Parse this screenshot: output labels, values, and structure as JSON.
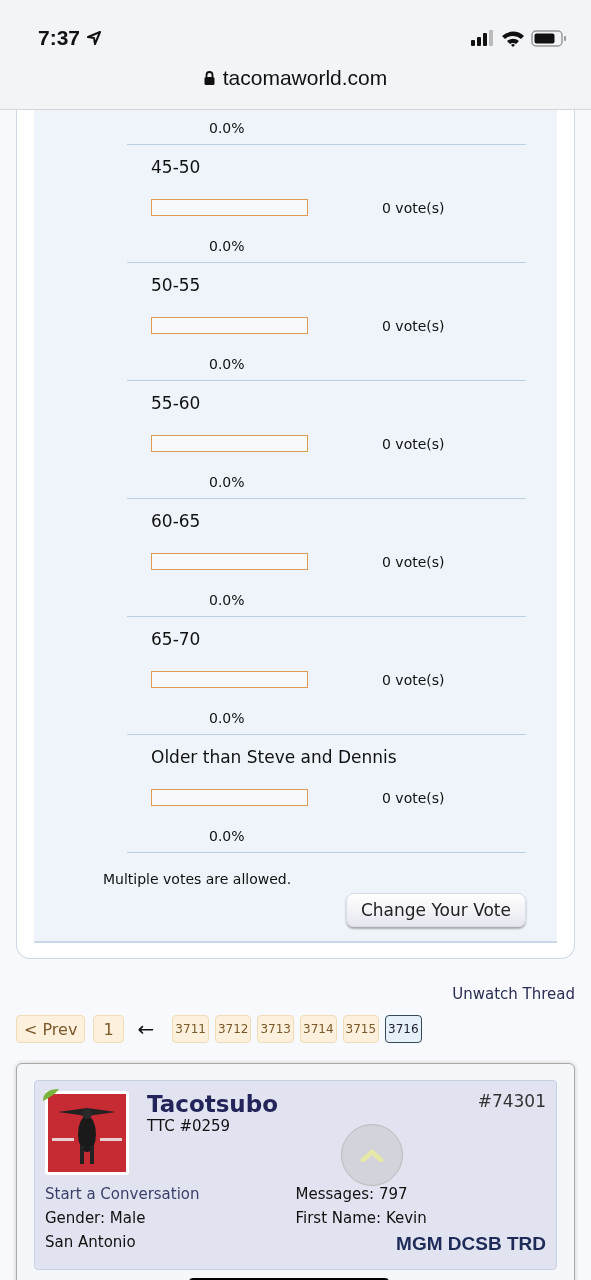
{
  "status_bar": {
    "time": "7:37"
  },
  "browser": {
    "url": "tacomaworld.com"
  },
  "poll": {
    "cut_option": {
      "percent": "0.0%"
    },
    "options": [
      {
        "label": "45-50",
        "level": 0,
        "votes": "0 vote(s)",
        "percent": "0.0%"
      },
      {
        "label": "50-55",
        "level": 0,
        "votes": "0 vote(s)",
        "percent": "0.0%"
      },
      {
        "label": "55-60",
        "level": 0,
        "votes": "0 vote(s)",
        "percent": "0.0%"
      },
      {
        "label": "60-65",
        "level": 0,
        "votes": "0 vote(s)",
        "percent": "0.0%"
      },
      {
        "label": "65-70",
        "level": 0,
        "votes": "0 vote(s)",
        "percent": "0.0%"
      },
      {
        "label": "Older than Steve and Dennis",
        "level": 0,
        "votes": "0 vote(s)",
        "percent": "0.0%"
      }
    ],
    "note": "Multiple votes are allowed.",
    "button": "Change Your Vote"
  },
  "unwatch": "Unwatch Thread",
  "pagination": {
    "prev": "< Prev",
    "first": "1",
    "gap": "←",
    "pages": [
      {
        "label": "3711",
        "selected": false
      },
      {
        "label": "3712",
        "selected": false
      },
      {
        "label": "3713",
        "selected": false
      },
      {
        "label": "3714",
        "selected": false
      },
      {
        "label": "3715",
        "selected": false
      },
      {
        "label": "3716",
        "selected": true
      }
    ]
  },
  "post": {
    "username": "Tacotsubo",
    "title": "TTC #0259",
    "number": "#74301",
    "conversation": "Start a Conversation",
    "left": [
      "Gender:  Male",
      "San Antonio"
    ],
    "right": [
      "Messages:  797",
      "First Name:  Kevin"
    ],
    "vehicle": "MGM DCSB TRD"
  }
}
